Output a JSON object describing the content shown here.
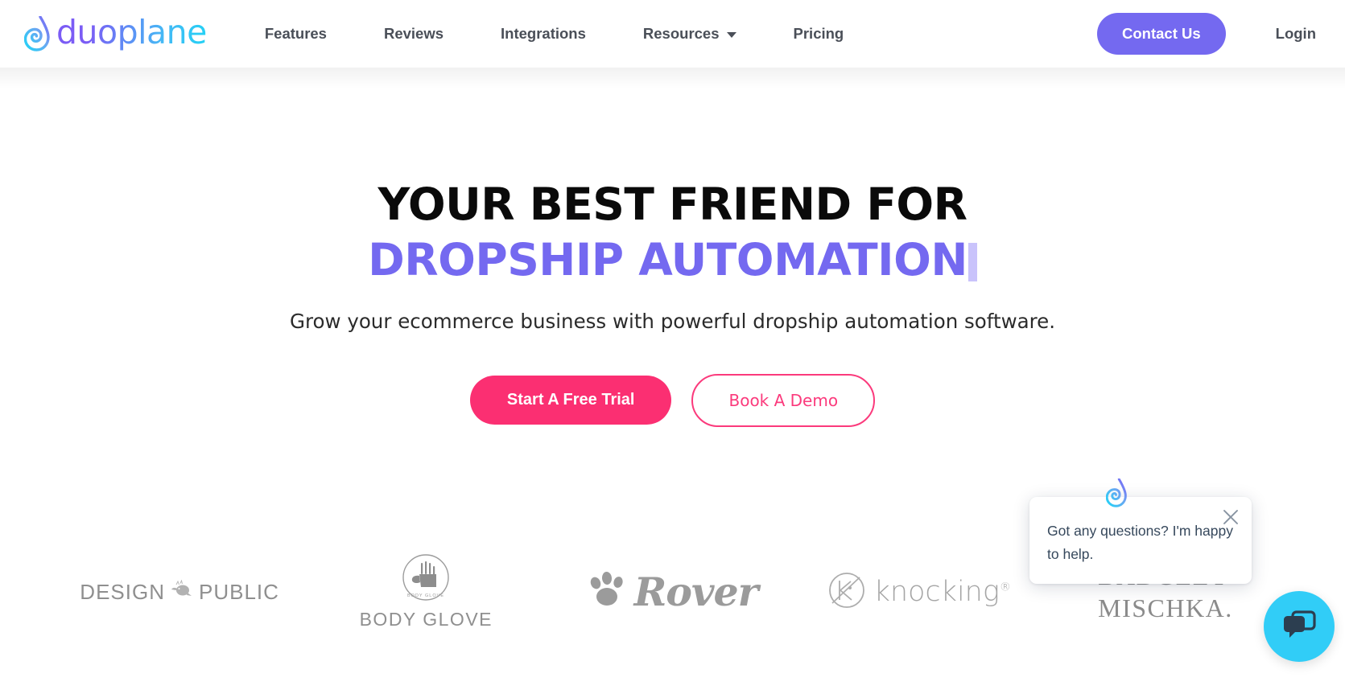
{
  "brand": {
    "name": "duoplane",
    "logo_icon": "duoplane-droplet-icon",
    "gradient_start": "#7b5cf5",
    "gradient_end": "#22d3f5"
  },
  "header": {
    "nav": [
      {
        "label": "Features",
        "has_dropdown": false
      },
      {
        "label": "Reviews",
        "has_dropdown": false
      },
      {
        "label": "Integrations",
        "has_dropdown": false
      },
      {
        "label": "Resources",
        "has_dropdown": true
      },
      {
        "label": "Pricing",
        "has_dropdown": false
      }
    ],
    "contact_label": "Contact Us",
    "contact_color": "#7469f0",
    "login_label": "Login",
    "nav_text_color": "#4a4f58"
  },
  "hero": {
    "title_line1": "YOUR BEST FRIEND FOR",
    "title_line2": "DROPSHIP AUTOMATION",
    "title_line2_color": "#7469f0",
    "has_typing_cursor": true,
    "subtitle": "Grow your ecommerce business with powerful dropship automation software.",
    "cta_primary": "Start A Free Trial",
    "cta_primary_color": "#fb2f72",
    "cta_secondary": "Book A Demo",
    "cta_secondary_color": "#fb3a7c"
  },
  "logos": [
    {
      "name": "Design Public",
      "text": "DESIGN",
      "text2": "PUBLIC",
      "icon": "bird-icon"
    },
    {
      "name": "Body Glove",
      "text": "BODY GLOVE",
      "icon": "hand-circle-icon"
    },
    {
      "name": "Rover",
      "text": "Rover",
      "icon": "paw-print-icon"
    },
    {
      "name": "knocking",
      "text": "knocking",
      "registered": "®",
      "icon": "knocking-circle-icon"
    },
    {
      "name": "Badgley Mischka",
      "text": "BADGLEY",
      "text2": "MISCHKA."
    }
  ],
  "chat": {
    "message": "Got any questions? I'm happy to help.",
    "close_icon": "close-icon",
    "avatar_icon": "duoplane-droplet-icon",
    "fab_icon": "chat-bubbles-icon",
    "fab_color": "#31cdf7"
  }
}
